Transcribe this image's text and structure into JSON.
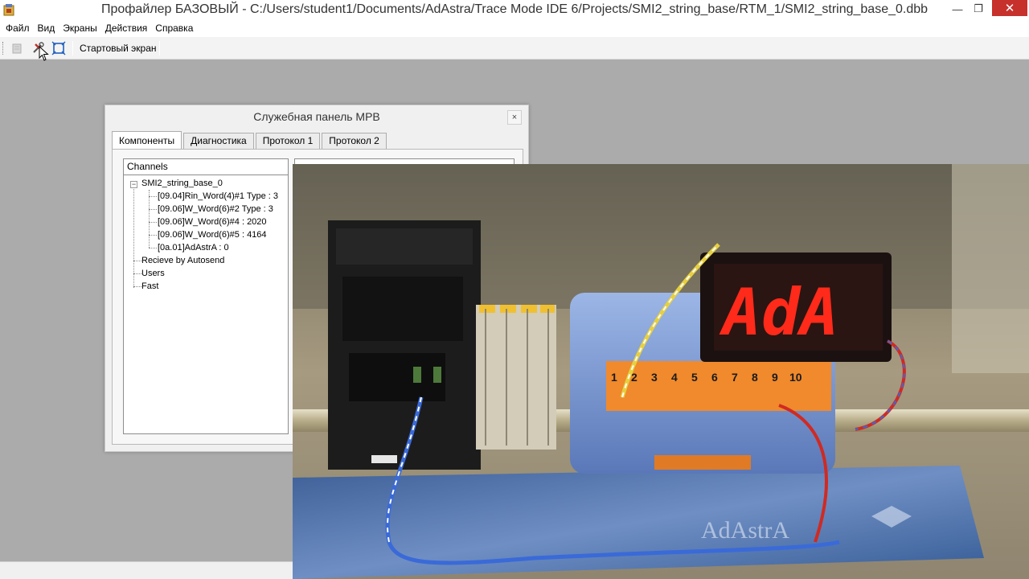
{
  "window": {
    "title": "Профайлер БАЗОВЫЙ - C:/Users/student1/Documents/AdAstra/Trace Mode IDE 6/Projects/SMI2_string_base/RTM_1/SMI2_string_base_0.dbb",
    "minimize": "—",
    "maximize": "❐",
    "close": "✕"
  },
  "menu": {
    "items": [
      "Файл",
      "Вид",
      "Экраны",
      "Действия",
      "Справка"
    ]
  },
  "toolbar": {
    "start_screen": "Стартовый экран"
  },
  "dialog": {
    "title": "Служебная панель МРВ",
    "close": "×",
    "tabs": [
      "Компоненты",
      "Диагностика",
      "Протокол 1",
      "Протокол 2"
    ],
    "tree_header": "Channels",
    "tree": {
      "root": "SMI2_string_base_0",
      "children": [
        "[09.04]Rin_Word(4)#1 Type : 3",
        "[09.06]W_Word(6)#2 Type : 3",
        "[09.06]W_Word(6)#4 : 2020",
        "[09.06]W_Word(6)#5 : 4164",
        "[0a.01]AdAstrA : 0"
      ],
      "others": [
        "Recieve by Autosend",
        "Users",
        "Fast"
      ]
    }
  },
  "video": {
    "display_text": "AdA",
    "terminal_numbers": [
      "1",
      "2",
      "3",
      "4",
      "5",
      "6",
      "7",
      "8",
      "9",
      "10"
    ],
    "mat_logo": "AdAstrA"
  },
  "colors": {
    "close_red": "#c7312b",
    "led_red": "#ff2a1a",
    "module_blue": "#6f8fd0",
    "terminal_orange": "#f08a2c"
  }
}
